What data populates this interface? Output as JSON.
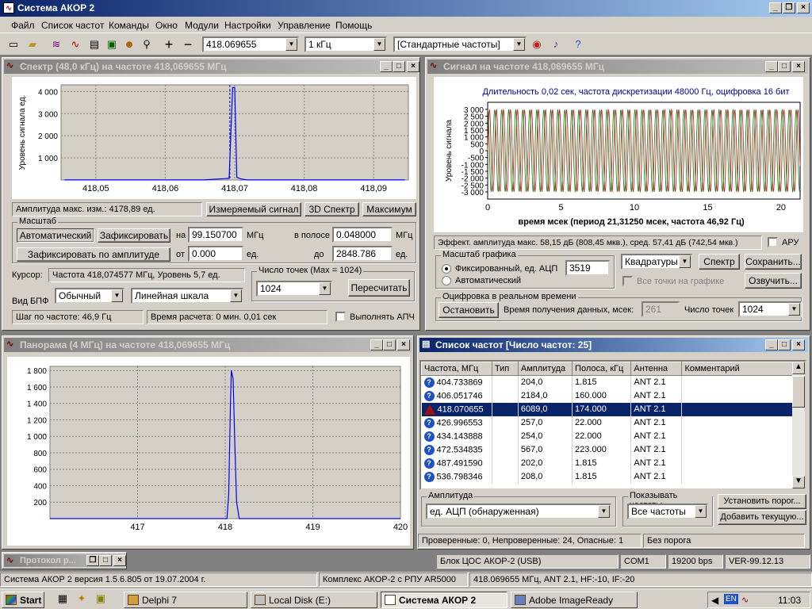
{
  "app": {
    "title": "Система АКОР 2"
  },
  "menu": [
    "Файл",
    "Список частот",
    "Команды",
    "Окно",
    "Модули",
    "Настройки",
    "Управление",
    "Помощь"
  ],
  "toolbar": {
    "freq_value": "418.069655",
    "step_value": "1 кГц",
    "freq_set_value": "[Стандартные частоты]"
  },
  "spectrum": {
    "title": "Спектр (48,0 кГц)  на частоте 418,069655 МГц",
    "amp_label": "Амплитуда макс. изм.: 4178,89 ед.",
    "btn_measured": "Измеряемый сигнал",
    "btn_3d": "3D Спектр",
    "btn_max": "Максимум",
    "scale_group": "Масштаб",
    "btn_auto": "Автоматический",
    "btn_fix": "Зафиксировать",
    "lbl_at": "на",
    "at_value": "99.150700",
    "lbl_mhz1": "МГц",
    "lbl_band": "в полосе",
    "band_value": "0.048000",
    "lbl_mhz2": "МГц",
    "btn_fix_amp": "Зафиксировать по амплитуде",
    "lbl_from": "от",
    "from_value": "0.000",
    "lbl_unit1": "ед.",
    "lbl_to": "до",
    "to_value": "2848.786",
    "lbl_unit2": "ед.",
    "cursor_label": "Курсор:",
    "cursor_value": "Частота 418,074577 МГц, Уровень 5,7 ед.",
    "points_group": "Число точек (Max = 1024)",
    "points_value": "1024",
    "btn_recalc": "Пересчитать",
    "fft_label": "Вид БПФ",
    "fft_type": "Обычный",
    "fft_scale": "Линейная шкала",
    "step_label": "Шаг по частоте: 46,9 Гц",
    "calc_time": "Время расчета: 0 мин. 0,01 сек",
    "apch_label": "Выполнять АПЧ"
  },
  "spectrum_chart": {
    "type": "line",
    "title": "",
    "xlabel": "",
    "ylabel": "Уровень сигнала ед.",
    "xlim": [
      418.045,
      418.095
    ],
    "ylim": [
      0,
      4300
    ],
    "xticks": [
      "418,05",
      "418,06",
      "418,07",
      "418,08",
      "418,09"
    ],
    "xtick_values": [
      418.05,
      418.06,
      418.07,
      418.08,
      418.09
    ],
    "yticks": [
      "1 000",
      "2 000",
      "3 000",
      "4 000"
    ],
    "ytick_values": [
      1000,
      2000,
      3000,
      4000
    ],
    "x": [
      418.0455,
      418.0655,
      418.0685,
      418.0692,
      418.0697,
      418.07,
      418.0703,
      418.071,
      418.0718,
      418.0945
    ],
    "values": [
      5,
      5,
      60,
      80,
      4178,
      4178,
      120,
      40,
      5,
      5
    ],
    "cursor_x": 418.0693
  },
  "signal": {
    "title": "Сигнал на частоте 418,069655 МГц",
    "effect_label": "Эффект. амплитуда макс. 58,15 дБ (808,45 мкв.), сред. 57,41 дБ (742,54 мкв.)",
    "aru_label": "АРУ",
    "scale_group": "Масштаб графика",
    "radio_fixed": "Фиксированный, ед. АЦП",
    "fixed_value": "3519",
    "radio_auto": "Автоматический",
    "mode_value": "Квадратуры",
    "btn_spectrum": "Спектр",
    "btn_save": "Сохранить...",
    "all_points_label": "Все точки на графике",
    "btn_sound": "Озвучить...",
    "rt_group": "Оцифровка в реальном времени",
    "btn_stop": "Остановить",
    "rt_time_label": "Время получения данных, мсек:",
    "rt_time_value": "261",
    "points_label": "Число точек",
    "points_value": "1024"
  },
  "signal_chart": {
    "type": "line",
    "title": "Длительность 0,02 сек, частота дискретизации 48000 Гц, оцифровка 16 бит",
    "xlabel": "время мсек (период 21,31250 мсек, частота 46,92 Гц)",
    "ylabel": "Уровень сигнала",
    "xlim": [
      0,
      21.3
    ],
    "ylim": [
      -3519,
      3519
    ],
    "xticks": [
      "0",
      "5",
      "10",
      "15",
      "20"
    ],
    "xtick_values": [
      0,
      5,
      10,
      15,
      20
    ],
    "yticks": [
      "3 000",
      "2 500",
      "2 000",
      "1 500",
      "1 000",
      "500",
      "0",
      "-500",
      "-1 000",
      "-1 500",
      "-2 000",
      "-2 500",
      "-3 000"
    ],
    "ytick_values": [
      3000,
      2500,
      2000,
      1500,
      1000,
      500,
      0,
      -500,
      -1000,
      -1500,
      -2000,
      -2500,
      -3000
    ],
    "series": [
      {
        "amplitude": 3000,
        "period_ms": 0.478,
        "phase": 0,
        "color": "#cc2020"
      },
      {
        "amplitude": 3000,
        "period_ms": 0.478,
        "phase": 1.5708,
        "color": "#208020"
      }
    ]
  },
  "panorama": {
    "title": "Панорама (4 МГц) на частоте 418,069655 МГц"
  },
  "panorama_chart": {
    "type": "line",
    "title": "",
    "xlabel": "",
    "ylabel": "",
    "xlim": [
      416.0,
      420.0
    ],
    "ylim": [
      0,
      1850
    ],
    "xticks": [
      "417",
      "418",
      "419",
      "420"
    ],
    "xtick_values": [
      417,
      418,
      419,
      420
    ],
    "yticks": [
      "200",
      "400",
      "600",
      "800",
      "1 000",
      "1 200",
      "1 400",
      "1 600",
      "1 800"
    ],
    "ytick_values": [
      200,
      400,
      600,
      800,
      1000,
      1200,
      1400,
      1600,
      1800
    ],
    "x": [
      416.0,
      418.02,
      418.04,
      418.06,
      418.07,
      418.09,
      418.11,
      418.13,
      418.16,
      420.0
    ],
    "values": [
      0,
      0,
      300,
      1400,
      1800,
      1700,
      900,
      200,
      0,
      0
    ]
  },
  "freq_list": {
    "title": "Список частот [Число частот: 25]",
    "columns": [
      "Частота, МГц",
      "Тип",
      "Амплитуда",
      "Полоса, кГц",
      "Антенна",
      "Комментарий"
    ],
    "rows": [
      {
        "freq": "404.733869",
        "amp": "204,0",
        "band": "1.815",
        "ant": "ANT 2.1",
        "icon": "question"
      },
      {
        "freq": "406.051746",
        "amp": "2184,0",
        "band": "160.000",
        "ant": "ANT 2.1",
        "icon": "question"
      },
      {
        "freq": "418.070655",
        "amp": "6089,0",
        "band": "174.000",
        "ant": "ANT 2.1",
        "icon": "warning",
        "selected": true
      },
      {
        "freq": "426.996553",
        "amp": "257,0",
        "band": "22.000",
        "ant": "ANT 2.1",
        "icon": "question"
      },
      {
        "freq": "434.143888",
        "amp": "254,0",
        "band": "22.000",
        "ant": "ANT 2.1",
        "icon": "question"
      },
      {
        "freq": "472.534835",
        "amp": "567,0",
        "band": "223.000",
        "ant": "ANT 2.1",
        "icon": "question"
      },
      {
        "freq": "487.491590",
        "amp": "202,0",
        "band": "1.815",
        "ant": "ANT 2.1",
        "icon": "question"
      },
      {
        "freq": "536.798346",
        "amp": "208,0",
        "band": "1.815",
        "ant": "ANT 2.1",
        "icon": "question"
      }
    ],
    "amp_group": "Амплитуда",
    "amp_value": "ед. АЦП (обнаруженная)",
    "show_group": "Показывать частоты",
    "show_value": "Все частоты",
    "btn_threshold": "Установить порог...",
    "btn_add": "Добавить текущую...",
    "status_checked": "Проверенные: 0, Непроверенные: 24, Опасные: 1",
    "status_threshold": "Без порога"
  },
  "protocol": {
    "title": "Протокол р..."
  },
  "statusbar": {
    "dsp": "Блок ЦОС АКОР-2 (USB)",
    "com": "COM1",
    "baud": "19200 bps",
    "ver": "VER-99.12.13",
    "version": "Система АКОР 2 версия 1.5.6.805 от 19.07.2004 г.",
    "complex": "Комплекс АКОР-2 с РПУ AR5000",
    "cur": "418.069655 МГц, ANT 2.1, HF:-10, IF:-20"
  },
  "taskbar": {
    "start": "Start",
    "tasks": [
      "Delphi 7",
      "Local Disk (E:)",
      "Система АКОР 2",
      "Adobe ImageReady"
    ],
    "lang": "EN",
    "clock": "11:03"
  }
}
